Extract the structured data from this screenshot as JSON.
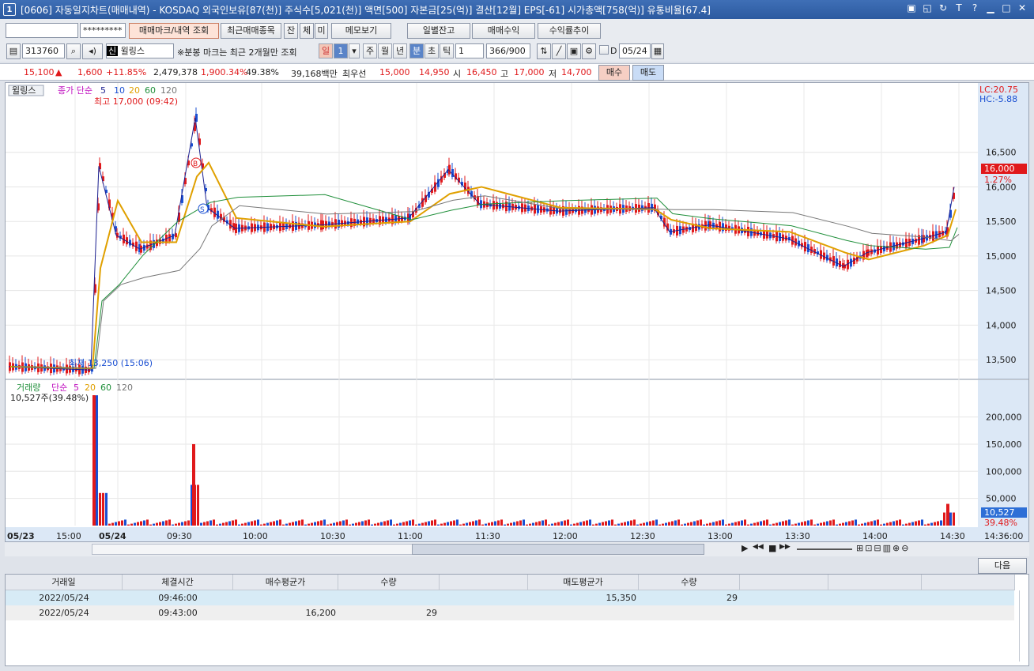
{
  "window": {
    "badge": "1",
    "title": "[0606] 자동일지차트(매매내역) - KOSDAQ 외국인보유[87(천)] 주식수[5,021(천)] 액면[500] 자본금[25(억)] 결산[12월] EPS[-61] 시가총액[758(억)] 유통비율[67.4]",
    "controls": [
      "▣",
      "◱",
      "↻",
      "T",
      "?",
      "▁",
      "□",
      "✕"
    ]
  },
  "toolbar1": {
    "account_value": "",
    "password_value": "*********",
    "buttons": [
      "매매마크/내역 조회",
      "최근매매종목",
      "잔",
      "체",
      "미",
      "메모보기"
    ],
    "right_buttons": [
      "일별잔고",
      "매매수익",
      "수익률추이"
    ]
  },
  "toolbar2": {
    "code": "313760",
    "stock_badge": "신",
    "stock_name": "윌링스",
    "note": "※분봉 마크는 최근 2개월만 조회",
    "periods": [
      "일",
      "1",
      "주",
      "월",
      "년",
      "분",
      "초",
      "틱"
    ],
    "interval": "1",
    "count": "366/900",
    "date_checkbox": "D",
    "date": "05/24"
  },
  "quote": {
    "price": "15,100",
    "arrow": "▲",
    "change": "1,600",
    "change_pct": "+11.85%",
    "volume": "2,479,378",
    "vol_ratio": "1,900.34%",
    "turnover": "49.38%",
    "amount": "39,168백만",
    "best_label": "최우선",
    "ask": "15,000",
    "bid": "14,950",
    "open_label": "시",
    "open": "16,450",
    "high_label": "고",
    "high": "17,000",
    "low_label": "저",
    "low": "14,700",
    "buy": "매수",
    "sell": "매도"
  },
  "chart": {
    "legend_stock": "윌링스",
    "legend_price": "종가 단순",
    "ma_periods": [
      "5",
      "10",
      "20",
      "60",
      "120"
    ],
    "lc": "LC:20.75",
    "hc": "HC:-5.88",
    "current_price": "16,000",
    "current_pct": "1.27%",
    "high_note": "최고 17,000 (09:42)",
    "low_note": "최저 13,250 (15:06)",
    "marker_buy": "B",
    "marker_sell": "S",
    "price_ticks": [
      "16,500",
      "16,000",
      "15,500",
      "15,000",
      "14,500",
      "14,000",
      "13,500"
    ],
    "volume_legend": "거래량",
    "volume_label": "10,527주(39.48%)",
    "volume_ma": [
      "5",
      "20",
      "60",
      "120"
    ],
    "volume_legend_type": "단순",
    "volume_ticks": [
      "200,000",
      "150,000",
      "100,000",
      "50,000"
    ],
    "current_volume": "10,527",
    "current_vol_pct": "39.48%",
    "time_labels": [
      "05/23",
      "15:00",
      "05/24",
      "09:30",
      "10:00",
      "10:30",
      "11:00",
      "11:30",
      "12:00",
      "12:30",
      "13:00",
      "13:30",
      "14:00",
      "14:30",
      "14:36:00"
    ],
    "colors": {
      "up": "#e0191b",
      "down": "#1a4fd2",
      "ma5": "#1b1f8f",
      "ma10": "#e0a000",
      "ma20": "#1f8f3a",
      "ma60": "#8a5a00",
      "ma120": "#777777",
      "vol_ma5": "#c010c0"
    }
  },
  "chart_data": {
    "type": "line",
    "title": "",
    "xlabel": "",
    "ylabel": "",
    "x": [
      "05/23 15:00",
      "05/24 09:00",
      "09:05",
      "09:10",
      "09:20",
      "09:30",
      "09:42",
      "09:50",
      "10:00",
      "10:30",
      "11:00",
      "11:20",
      "11:30",
      "12:00",
      "12:30",
      "12:45",
      "13:00",
      "13:30",
      "13:50",
      "14:00",
      "14:20",
      "14:30",
      "14:36"
    ],
    "series": [
      {
        "name": "종가",
        "values": [
          13400,
          13350,
          16300,
          15300,
          15100,
          15300,
          17000,
          15700,
          15400,
          15450,
          15550,
          16250,
          15750,
          15650,
          15700,
          15350,
          15450,
          15250,
          14850,
          15050,
          15250,
          15350,
          16000
        ]
      }
    ],
    "ylim": [
      13250,
      17000
    ],
    "volume": {
      "x": [
        "05/24 09:00",
        "09:42",
        "14:30"
      ],
      "values": [
        240000,
        150000,
        40000
      ],
      "ylim": [
        0,
        230000
      ]
    }
  },
  "nav": {
    "next": "다음",
    "icons": [
      "▶",
      "◀◀",
      "■",
      "▶▶"
    ]
  },
  "table": {
    "columns": [
      "거래일",
      "체결시간",
      "매수평균가",
      "수량",
      "",
      "매도평균가",
      "수량",
      "",
      "",
      ""
    ],
    "rows": [
      [
        "2022/05/24",
        "09:46:00",
        "",
        "",
        "",
        "15,350",
        "29",
        "",
        "",
        ""
      ],
      [
        "2022/05/24",
        "09:43:00",
        "16,200",
        "29",
        "",
        "",
        "",
        "",
        "",
        ""
      ]
    ]
  }
}
